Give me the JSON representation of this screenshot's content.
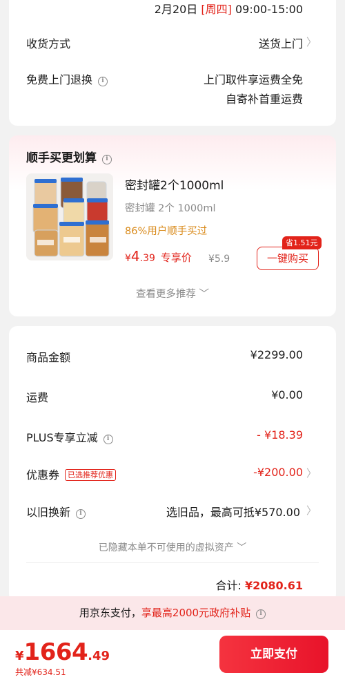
{
  "delivery": {
    "date": "2月20日",
    "weekday": "[周四]",
    "time": "09:00-15:00",
    "method_label": "收货方式",
    "method_value": "送货上门",
    "return_label": "免费上门退换",
    "return_value_line1": "上门取件享运费全免",
    "return_value_line2": "自寄补首重运费"
  },
  "recommendation": {
    "title": "顺手买更划算",
    "product": {
      "name": "密封罐2个1000ml",
      "spec": "密封罐 2个 1000ml",
      "tip": "86%用户顺手买过",
      "price_symbol": "¥",
      "price_int": "4",
      "price_dec": ".39",
      "exclusive_label": "专享价",
      "original_price": "¥5.9",
      "save_tag": "省1.51元",
      "buy_label": "一键购买"
    },
    "more_label": "查看更多推荐"
  },
  "summary": {
    "rows": [
      {
        "label": "商品金额",
        "value": "¥2299.00"
      },
      {
        "label": "运费",
        "value": "¥0.00"
      },
      {
        "label": "PLUS专享立减",
        "value": "- ¥18.39"
      },
      {
        "label": "优惠券",
        "tag": "已选推荐优惠",
        "value": "-¥200.00"
      },
      {
        "label": "以旧换新",
        "value": "选旧品，最高可抵¥570.00"
      }
    ],
    "hidden_assets": "已隐藏本单不可使用的虚拟资产",
    "total_label": "合计:",
    "total_value": "¥2080.61"
  },
  "subsidy": {
    "prefix": "用京东支付，",
    "highlight": "享最高2000元政府补贴"
  },
  "bottom": {
    "price_symbol": "¥",
    "price_int": "1664",
    "price_dec": ".49",
    "reduced": "共减¥634.51",
    "pay_label": "立即支付"
  },
  "colors": {
    "accent": "#e2231a",
    "tip": "#d98a1a",
    "subsidy_bg": "#fbe7e9"
  }
}
